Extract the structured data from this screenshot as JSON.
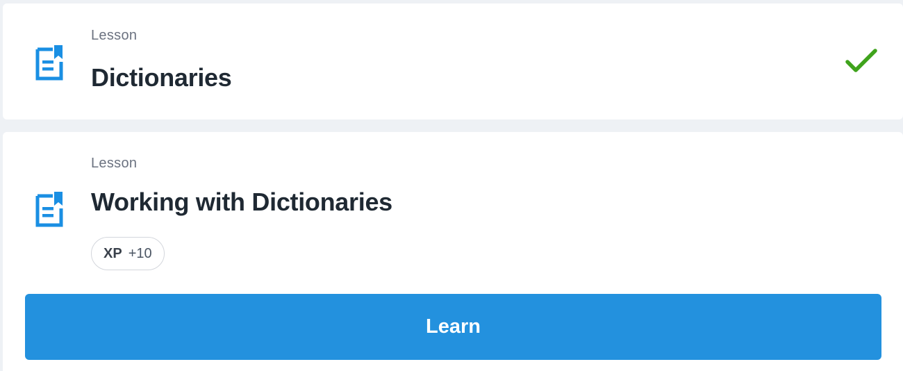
{
  "colors": {
    "accent": "#2391de",
    "check": "#3fa31c",
    "icon": "#1a8fe3"
  },
  "lessons": [
    {
      "kind": "Lesson",
      "title": "Dictionaries",
      "icon": "lesson-document-icon",
      "status": "completed",
      "status_icon": "checkmark-icon"
    },
    {
      "kind": "Lesson",
      "title": "Working with Dictionaries",
      "icon": "lesson-document-icon",
      "xp": {
        "label": "XP",
        "value": "+10"
      },
      "action_label": "Learn"
    }
  ]
}
